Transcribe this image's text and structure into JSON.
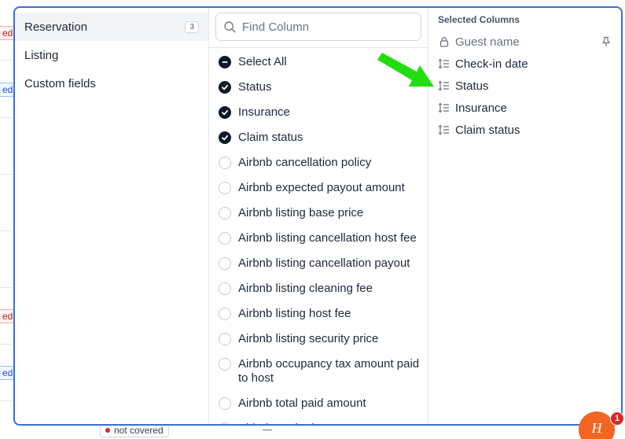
{
  "background": {
    "badges": [
      "ed",
      "ed",
      "ed",
      "ed"
    ],
    "bottom_badge": "not covered"
  },
  "categories": [
    {
      "label": "Reservation",
      "count": "3",
      "active": true
    },
    {
      "label": "Listing"
    },
    {
      "label": "Custom fields"
    }
  ],
  "search": {
    "placeholder": "Find Column",
    "value": ""
  },
  "options": [
    {
      "label": "Select All",
      "state": "partial"
    },
    {
      "label": "Status",
      "state": "checked"
    },
    {
      "label": "Insurance",
      "state": "checked"
    },
    {
      "label": "Claim status",
      "state": "checked"
    },
    {
      "label": "Airbnb cancellation policy",
      "state": "unchecked"
    },
    {
      "label": "Airbnb expected payout amount",
      "state": "unchecked"
    },
    {
      "label": "Airbnb listing base price",
      "state": "unchecked"
    },
    {
      "label": "Airbnb listing cancellation host fee",
      "state": "unchecked"
    },
    {
      "label": "Airbnb listing cancellation payout",
      "state": "unchecked"
    },
    {
      "label": "Airbnb listing cleaning fee",
      "state": "unchecked"
    },
    {
      "label": "Airbnb listing host fee",
      "state": "unchecked"
    },
    {
      "label": "Airbnb listing security price",
      "state": "unchecked"
    },
    {
      "label": "Airbnb occupancy tax amount paid to host",
      "state": "unchecked"
    },
    {
      "label": "Airbnb total paid amount",
      "state": "unchecked"
    },
    {
      "label": "Airbnb total price",
      "state": "unchecked"
    }
  ],
  "selected": {
    "title": "Selected Columns",
    "items": [
      {
        "label": "Guest name",
        "locked": true,
        "icon": "lock-icon",
        "pinned": true
      },
      {
        "label": "Check-in date",
        "icon": "drag-handle-icon"
      },
      {
        "label": "Status",
        "icon": "drag-handle-icon"
      },
      {
        "label": "Insurance",
        "icon": "drag-handle-icon"
      },
      {
        "label": "Claim status",
        "icon": "drag-handle-icon"
      }
    ]
  },
  "help_widget": {
    "glyph": "H",
    "badge_count": "1"
  },
  "colors": {
    "modal_border": "#3b6fd4",
    "arrow": "#22dd11",
    "help_bg": "#f26522",
    "checkbox_checked": "#111827"
  }
}
